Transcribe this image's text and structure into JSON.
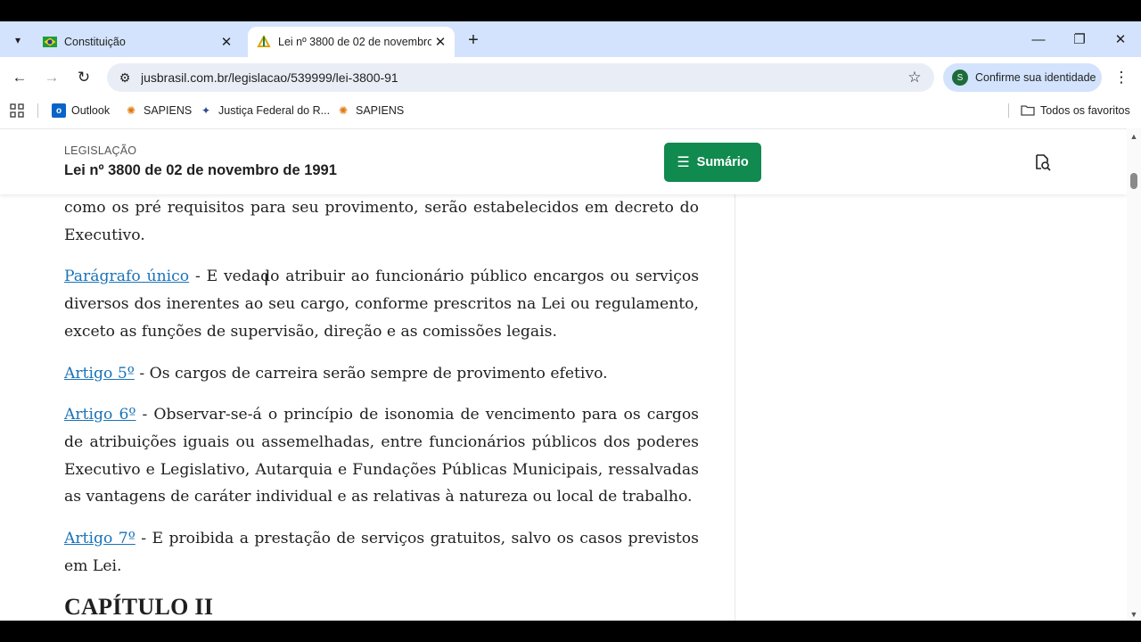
{
  "browser": {
    "tabs": [
      {
        "title": "Constituição",
        "active": false
      },
      {
        "title": "Lei nº 3800 de 02 de novembro",
        "active": true
      }
    ],
    "new_tab_label": "+",
    "url": "jusbrasil.com.br/legislacao/539999/lei-3800-91",
    "profile_label": "Confirme sua identidade",
    "profile_initial": "S",
    "bookmarks": [
      "Outlook",
      "SAPIENS",
      "Justiça Federal do R...",
      "SAPIENS"
    ],
    "all_bookmarks_label": "Todos os favoritos"
  },
  "header": {
    "kicker": "LEGISLAÇÃO",
    "title": "Lei nº 3800 de 02 de novembro de 1991",
    "sumario_label": "Sumário"
  },
  "content": {
    "p0": "como os pré requisitos para seu provimento, serão estabelecidos em decreto do Executivo.",
    "p1_link": "Parágrafo único",
    "p1_text": " - E vedado atribuir ao funcionário público encargos ou serviços diversos dos inerentes ao seu cargo, conforme prescritos na Lei ou regulamento, exceto as funções de supervisão, direção e as comissões legais.",
    "p2_link": "Artigo 5º",
    "p2_text": " - Os cargos de carreira serão sempre de provimento efetivo.",
    "p3_link": "Artigo 6º",
    "p3_text": " - Observar-se-á o princípio de isonomia de vencimento para os cargos de atribuições iguais ou assemelhadas, entre funcionários públicos dos poderes Executivo e Legislativo, Autarquia e Fundações Públicas Municipais, ressalvadas as vantagens de caráter individual e as relativas à natureza ou local de trabalho.",
    "p4_link": "Artigo 7º",
    "p4_text": " - E proibida a prestação de serviços gratuitos, salvo os casos previstos em Lei.",
    "heading": "CAPÍTULO II"
  }
}
